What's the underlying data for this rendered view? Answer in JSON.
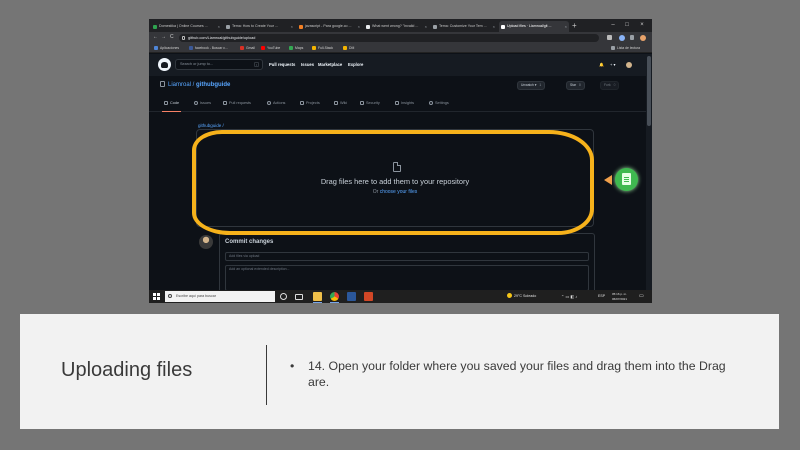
{
  "browser": {
    "tabs": [
      {
        "label": "Domestika | Online Courses ..."
      },
      {
        "label": "Tema: How to Create Your ..."
      },
      {
        "label": "javascript - Para google.co ..."
      },
      {
        "label": "What went wrong? \"Invalid ..."
      },
      {
        "label": "Tema: Customize Your Tem ..."
      },
      {
        "label": "Upload files · Liamroal/git ..."
      }
    ],
    "new_tab": "+",
    "window_controls": {
      "minimize": "–",
      "maximize": "□",
      "close": "×"
    },
    "nav": {
      "back": "←",
      "forward": "→",
      "reload": "C"
    },
    "url": "github.com/Liamroal/githubguide/upload",
    "bookmarks": [
      {
        "label": "Aplicaciones",
        "color": "#4f86d9"
      },
      {
        "label": "facebook - Buscar c...",
        "color": "#3b5998"
      },
      {
        "label": "Gmail",
        "color": "#d93025"
      },
      {
        "label": "YouTube",
        "color": "#ff0000"
      },
      {
        "label": "Maps",
        "color": "#34a853"
      },
      {
        "label": "Full-Stack",
        "color": "#f4b400"
      },
      {
        "label": "DM",
        "color": "#f4b400"
      }
    ],
    "reading_list": "Lista de lectura"
  },
  "github": {
    "search_placeholder": "Search or jump to...",
    "search_key": "/",
    "nav": [
      "Pull requests",
      "Issues",
      "Marketplace",
      "Explore"
    ],
    "right_icons": {
      "bell": "🔔",
      "plus": "+ ▾"
    },
    "repo": {
      "owner": "Liamroal",
      "sep": " / ",
      "name": "githubguide"
    },
    "buttons": [
      {
        "label": "Unwatch ▾",
        "count": "1"
      },
      {
        "label": "Star",
        "count": "0"
      },
      {
        "label": "Fork",
        "count": "0"
      }
    ],
    "tabs": [
      "Code",
      "Issues",
      "Pull requests",
      "Actions",
      "Projects",
      "Wiki",
      "Security",
      "Insights",
      "Settings"
    ],
    "breadcrumb": "githubguide /",
    "dropzone": {
      "title": "Drag files here to add them to your repository",
      "or": "Or ",
      "choose": "choose your files"
    },
    "commit": {
      "title": "Commit changes",
      "summary_placeholder": "Add files via upload",
      "description_placeholder": "Add an optional extended description..."
    }
  },
  "taskbar": {
    "search_placeholder": "Escribe aquí para buscar",
    "weather": "29°C  Soleado",
    "language": "ESP",
    "time": "05:16 p. m.",
    "date": "06/07/2021"
  },
  "annotation": {
    "highlight_color": "#f6b21b",
    "badge_color": "#3fb950"
  },
  "caption": {
    "title": "Uploading files",
    "bullet_marker": "•",
    "bullet": "14. Open your folder where you saved your files and drag them into the Drag are."
  }
}
